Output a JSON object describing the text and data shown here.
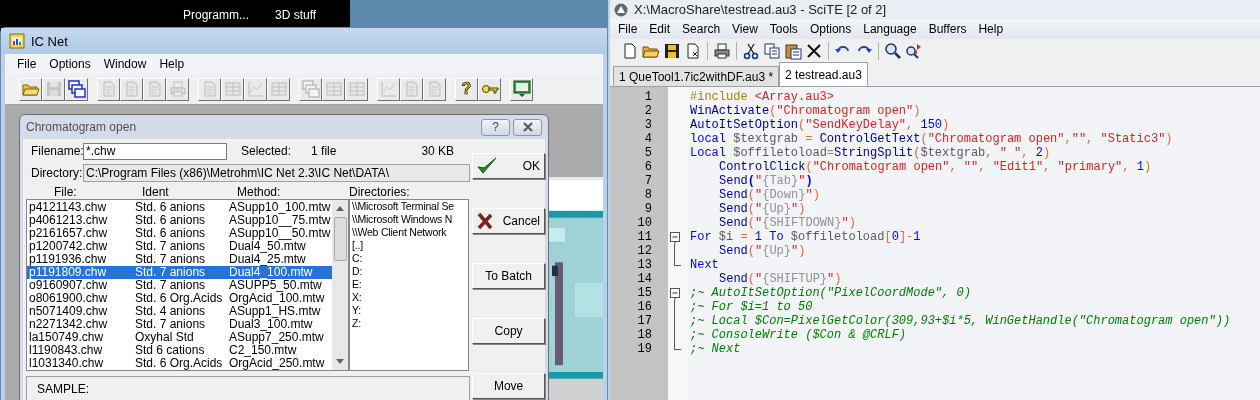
{
  "taskbar": {
    "items": [
      "Programm...",
      "3D stuff"
    ]
  },
  "icnet": {
    "title": "IC Net",
    "menu": [
      "File",
      "Options",
      "Window",
      "Help"
    ],
    "toolbar": [
      [
        {
          "kind": "folder",
          "disabled": false
        },
        {
          "kind": "disk",
          "disabled": true
        },
        {
          "kind": "windows",
          "disabled": false
        }
      ],
      [
        {
          "kind": "document",
          "disabled": true
        },
        {
          "kind": "document",
          "disabled": true
        },
        {
          "kind": "document",
          "disabled": true
        },
        {
          "kind": "print",
          "disabled": true
        }
      ],
      [
        {
          "kind": "document",
          "disabled": true
        },
        {
          "kind": "table",
          "disabled": true
        },
        {
          "kind": "chart",
          "disabled": true
        },
        {
          "kind": "table",
          "disabled": true
        }
      ],
      [
        {
          "kind": "windows",
          "disabled": true
        },
        {
          "kind": "table",
          "disabled": true
        },
        {
          "kind": "table",
          "disabled": true
        }
      ],
      [
        {
          "kind": "chart",
          "disabled": true
        },
        {
          "kind": "document",
          "disabled": true
        },
        {
          "kind": "document",
          "disabled": true
        }
      ],
      [
        {
          "kind": "help",
          "glyph": "?",
          "disabled": false
        },
        {
          "kind": "key",
          "disabled": false
        }
      ],
      [
        {
          "kind": "monitor",
          "disabled": false
        }
      ]
    ],
    "background_window": {
      "kind": "picture"
    },
    "dialog": {
      "title": "Chromatogram open",
      "help_button": "?",
      "filename": {
        "label": "Filename:",
        "value": "*.chw"
      },
      "selected_label": "Selected:",
      "selected_value": "1 file",
      "size": "30 KB",
      "directory": {
        "label": "Directory:",
        "value": "C:\\Program Files (x86)\\Metrohm\\IC Net 2.3\\IC Net\\DATA\\"
      },
      "columns": [
        {
          "label": "File:"
        },
        {
          "label": "Ident"
        },
        {
          "label": "Method:"
        }
      ],
      "files": [
        {
          "file": "p4121143.chw",
          "ident": "Std. 6 anions",
          "method": "ASupp10_100.mtw",
          "selected": false
        },
        {
          "file": "p4061213.chw",
          "ident": "Std. 6 anions",
          "method": "ASupp10__75.mtw",
          "selected": false
        },
        {
          "file": "p2161657.chw",
          "ident": "Std. 6 anions",
          "method": "ASupp10__50.mtw",
          "selected": false
        },
        {
          "file": "p1200742.chw",
          "ident": "Std. 7 anions",
          "method": "Dual4_50.mtw",
          "selected": false
        },
        {
          "file": "p1191936.chw",
          "ident": "Std. 7 anions",
          "method": "Dual4_25.mtw",
          "selected": false
        },
        {
          "file": "p1191809.chw",
          "ident": "Std. 7 anions",
          "method": "Dual4_100.mtw",
          "selected": true
        },
        {
          "file": "o9160907.chw",
          "ident": "Std. 7 anions",
          "method": "ASUPP5_50.mtw",
          "selected": false
        },
        {
          "file": "o8061900.chw",
          "ident": "Std. 6 Org.Acids",
          "method": "OrgAcid_100.mtw",
          "selected": false
        },
        {
          "file": "n5071409.chw",
          "ident": "Std. 4 anions",
          "method": "ASupp1_HS.mtw",
          "selected": false
        },
        {
          "file": "n2271342.chw",
          "ident": "Std. 7 anions",
          "method": "Dual3_100.mtw",
          "selected": false
        },
        {
          "file": "la150749.chw",
          "ident": "Oxyhal Std",
          "method": "ASupp7_250.mtw",
          "selected": false
        },
        {
          "file": "l1190843.chw",
          "ident": "Std 6 cations",
          "method": "C2_150.mtw",
          "selected": false
        },
        {
          "file": "l1031340.chw",
          "ident": "Std. 6 Org.Acids",
          "method": "OrgAcid_250.mtw",
          "selected": false
        }
      ],
      "directories_label": {
        "label": "Directories:"
      },
      "directories": [
        "\\\\Microsoft Terminal Se",
        "\\\\Microsoft Windows N",
        "\\\\Web Client Network",
        "[..]",
        "C:",
        "D:",
        "E:",
        "X:",
        "Y:",
        "Z:"
      ],
      "sample_label": "SAMPLE:",
      "buttons": [
        {
          "label": "OK",
          "kind": "ok"
        },
        {
          "label": "Cancel",
          "kind": "cancel"
        },
        {
          "label": "To Batch",
          "kind": "plain"
        },
        {
          "label": "Copy",
          "kind": "plain"
        },
        {
          "label": "Move",
          "kind": "plain"
        }
      ]
    }
  },
  "scite": {
    "title": "X:\\MacroShare\\testread.au3 - SciTE [2 of 2]",
    "menu": [
      "File",
      "Edit",
      "Search",
      "View",
      "Tools",
      "Options",
      "Language",
      "Buffers",
      "Help"
    ],
    "toolbar": [
      [
        {
          "kind": "new"
        },
        {
          "kind": "open"
        },
        {
          "kind": "save"
        },
        {
          "kind": "close"
        }
      ],
      [
        {
          "kind": "print"
        }
      ],
      [
        {
          "kind": "cut"
        },
        {
          "kind": "copy"
        },
        {
          "kind": "paste"
        },
        {
          "kind": "delete"
        }
      ],
      [
        {
          "kind": "undo"
        },
        {
          "kind": "redo"
        }
      ],
      [
        {
          "kind": "find"
        },
        {
          "kind": "replace"
        }
      ]
    ],
    "tabs": [
      {
        "label": "1 QueTool1.7ic2withDF.au3 *",
        "selected": false
      },
      {
        "label": "2 testread.au3",
        "selected": true
      }
    ],
    "lines": [
      {
        "number": "1",
        "indented": false,
        "tokens": [
          {
            "kind": "pre",
            "text": "#include "
          },
          {
            "kind": "str",
            "text": "<Array.au3>"
          }
        ]
      },
      {
        "number": "2",
        "indented": false,
        "tokens": [
          {
            "kind": "func",
            "text": "WinActivate"
          },
          {
            "kind": "op",
            "text": "("
          },
          {
            "kind": "str",
            "text": "\"Chromatogram open\""
          },
          {
            "kind": "op",
            "text": ")"
          }
        ]
      },
      {
        "number": "3",
        "indented": false,
        "tokens": [
          {
            "kind": "func",
            "text": "AutoItSetOption"
          },
          {
            "kind": "op",
            "text": "("
          },
          {
            "kind": "str",
            "text": "\"SendKeyDelay\""
          },
          {
            "kind": "op",
            "text": ", "
          },
          {
            "kind": "num",
            "text": "150"
          },
          {
            "kind": "op",
            "text": ")"
          }
        ]
      },
      {
        "number": "4",
        "indented": false,
        "tokens": [
          {
            "kind": "kw",
            "text": "local "
          },
          {
            "kind": "var",
            "text": "$textgrab "
          },
          {
            "kind": "op",
            "text": "= "
          },
          {
            "kind": "func",
            "text": "ControlGetText"
          },
          {
            "kind": "op",
            "text": "("
          },
          {
            "kind": "str",
            "text": "\"Chromatogram open\""
          },
          {
            "kind": "op",
            "text": ","
          },
          {
            "kind": "str",
            "text": "\"\""
          },
          {
            "kind": "op",
            "text": ", "
          },
          {
            "kind": "str",
            "text": "\"Static3\""
          },
          {
            "kind": "op",
            "text": ")"
          }
        ]
      },
      {
        "number": "5",
        "indented": false,
        "tokens": [
          {
            "kind": "kw",
            "text": "Local "
          },
          {
            "kind": "var",
            "text": "$offiletoload"
          },
          {
            "kind": "op",
            "text": "="
          },
          {
            "kind": "func",
            "text": "StringSplit"
          },
          {
            "kind": "op",
            "text": "("
          },
          {
            "kind": "var",
            "text": "$textgrab"
          },
          {
            "kind": "op",
            "text": ", "
          },
          {
            "kind": "str",
            "text": "\" \""
          },
          {
            "kind": "op",
            "text": ", "
          },
          {
            "kind": "num",
            "text": "2"
          },
          {
            "kind": "op",
            "text": ")"
          }
        ]
      },
      {
        "number": "6",
        "indented": true,
        "tokens": [
          {
            "kind": "func",
            "text": "ControlClick"
          },
          {
            "kind": "op",
            "text": "("
          },
          {
            "kind": "str",
            "text": "\"Chromatogram open\""
          },
          {
            "kind": "op",
            "text": ", "
          },
          {
            "kind": "str",
            "text": "\"\""
          },
          {
            "kind": "op",
            "text": ", "
          },
          {
            "kind": "str",
            "text": "\"Edit1\""
          },
          {
            "kind": "op",
            "text": ", "
          },
          {
            "kind": "str",
            "text": "\"primary\""
          },
          {
            "kind": "op",
            "text": ", "
          },
          {
            "kind": "num",
            "text": "1"
          },
          {
            "kind": "op",
            "text": ")"
          }
        ]
      },
      {
        "number": "7",
        "indented": true,
        "tokens": [
          {
            "kind": "func",
            "text": "Send"
          },
          {
            "kind": "brace",
            "text": "("
          },
          {
            "kind": "str",
            "text": "\""
          },
          {
            "kind": "sendkey",
            "text": "{Tab}"
          },
          {
            "kind": "str",
            "text": "\""
          },
          {
            "kind": "brace",
            "text": ")"
          }
        ]
      },
      {
        "number": "8",
        "indented": true,
        "tokens": [
          {
            "kind": "func",
            "text": "Send"
          },
          {
            "kind": "op",
            "text": "("
          },
          {
            "kind": "str",
            "text": "\""
          },
          {
            "kind": "sendkey",
            "text": "{Down}"
          },
          {
            "kind": "str",
            "text": "\""
          },
          {
            "kind": "op",
            "text": ")"
          }
        ]
      },
      {
        "number": "9",
        "indented": true,
        "tokens": [
          {
            "kind": "func",
            "text": "Send"
          },
          {
            "kind": "op",
            "text": "("
          },
          {
            "kind": "str",
            "text": "\""
          },
          {
            "kind": "sendkey",
            "text": "{Up}"
          },
          {
            "kind": "str",
            "text": "\""
          },
          {
            "kind": "op",
            "text": ")"
          }
        ]
      },
      {
        "number": "10",
        "indented": true,
        "tokens": [
          {
            "kind": "func",
            "text": "Send"
          },
          {
            "kind": "op",
            "text": "("
          },
          {
            "kind": "str",
            "text": "\""
          },
          {
            "kind": "sendkey",
            "text": "{SHIFTDOWN}"
          },
          {
            "kind": "str",
            "text": "\""
          },
          {
            "kind": "op",
            "text": ")"
          }
        ]
      },
      {
        "number": "11",
        "indented": false,
        "fold": {
          "kind": "start"
        },
        "tokens": [
          {
            "kind": "kw",
            "text": "For "
          },
          {
            "kind": "var",
            "text": "$i "
          },
          {
            "kind": "op",
            "text": "= "
          },
          {
            "kind": "num",
            "text": "1 "
          },
          {
            "kind": "kw",
            "text": "To "
          },
          {
            "kind": "var",
            "text": "$offiletoload"
          },
          {
            "kind": "op",
            "text": "["
          },
          {
            "kind": "num",
            "text": "0"
          },
          {
            "kind": "op",
            "text": "]-"
          },
          {
            "kind": "num",
            "text": "1"
          }
        ]
      },
      {
        "number": "12",
        "indented": true,
        "fold": {
          "kind": "middle"
        },
        "tokens": [
          {
            "kind": "func",
            "text": "Send"
          },
          {
            "kind": "op",
            "text": "("
          },
          {
            "kind": "str",
            "text": "\""
          },
          {
            "kind": "sendkey",
            "text": "{Up}"
          },
          {
            "kind": "str",
            "text": "\""
          },
          {
            "kind": "op",
            "text": ")"
          }
        ]
      },
      {
        "number": "13",
        "indented": false,
        "fold": {
          "kind": "end"
        },
        "tokens": [
          {
            "kind": "kw",
            "text": "Next"
          }
        ]
      },
      {
        "number": "14",
        "indented": true,
        "tokens": [
          {
            "kind": "func",
            "text": "Send"
          },
          {
            "kind": "op",
            "text": "("
          },
          {
            "kind": "str",
            "text": "\""
          },
          {
            "kind": "sendkey",
            "text": "{SHIFTUP}"
          },
          {
            "kind": "str",
            "text": "\""
          },
          {
            "kind": "op",
            "text": ")"
          }
        ]
      },
      {
        "number": "15",
        "indented": false,
        "fold": {
          "kind": "start"
        },
        "tokens": [
          {
            "kind": "comment",
            "text": ";~ AutoItSetOption(\"PixelCoordMode\", 0)"
          }
        ]
      },
      {
        "number": "16",
        "indented": false,
        "fold": {
          "kind": "middle"
        },
        "tokens": [
          {
            "kind": "comment",
            "text": ";~ For $i=1 to 50"
          }
        ]
      },
      {
        "number": "17",
        "indented": false,
        "fold": {
          "kind": "middle"
        },
        "tokens": [
          {
            "kind": "comment",
            "text": ";~ Local $Con=PixelGetColor(309,93+$i*5, WinGetHandle(\"Chromatogram open\"))"
          }
        ]
      },
      {
        "number": "18",
        "indented": false,
        "fold": {
          "kind": "middle"
        },
        "tokens": [
          {
            "kind": "comment",
            "text": ";~ ConsoleWrite ($Con & @CRLF)"
          }
        ]
      },
      {
        "number": "19",
        "indented": false,
        "fold": {
          "kind": "end"
        },
        "tokens": [
          {
            "kind": "comment",
            "text": ";~ Next"
          }
        ]
      }
    ]
  }
}
